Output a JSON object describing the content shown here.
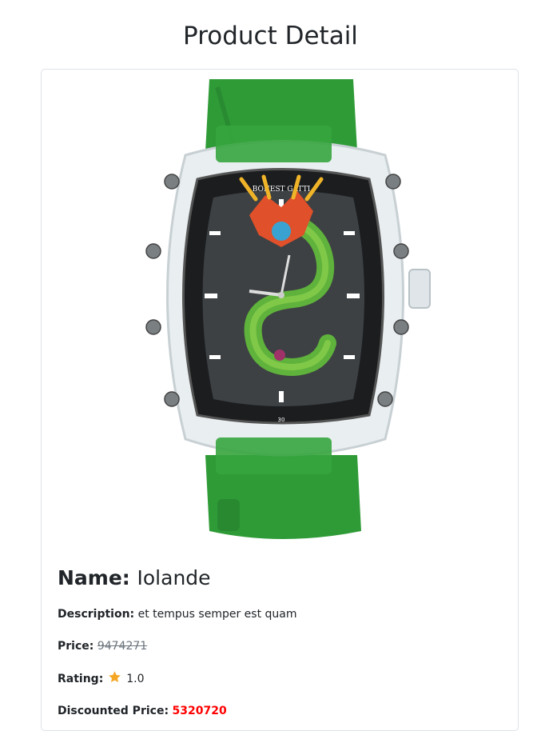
{
  "page": {
    "title": "Product Detail"
  },
  "product": {
    "image_alt": "BONEST GATTI green dragon skeleton watch",
    "brand_on_dial": "BONEST GATTI",
    "name_label": "Name:",
    "name": "Iolande",
    "description_label": "Description:",
    "description": "et tempus semper est quam",
    "price_label": "Price:",
    "price": "9474271",
    "rating_label": "Rating:",
    "rating_icon": "star-icon",
    "rating": "1.0",
    "discounted_price_label": "Discounted Price:",
    "discounted_price": "5320720"
  },
  "colors": {
    "strap": "#2e9a36",
    "discount_text": "#ff0000",
    "old_price_text": "#6c757d",
    "star": "#f5a623"
  }
}
